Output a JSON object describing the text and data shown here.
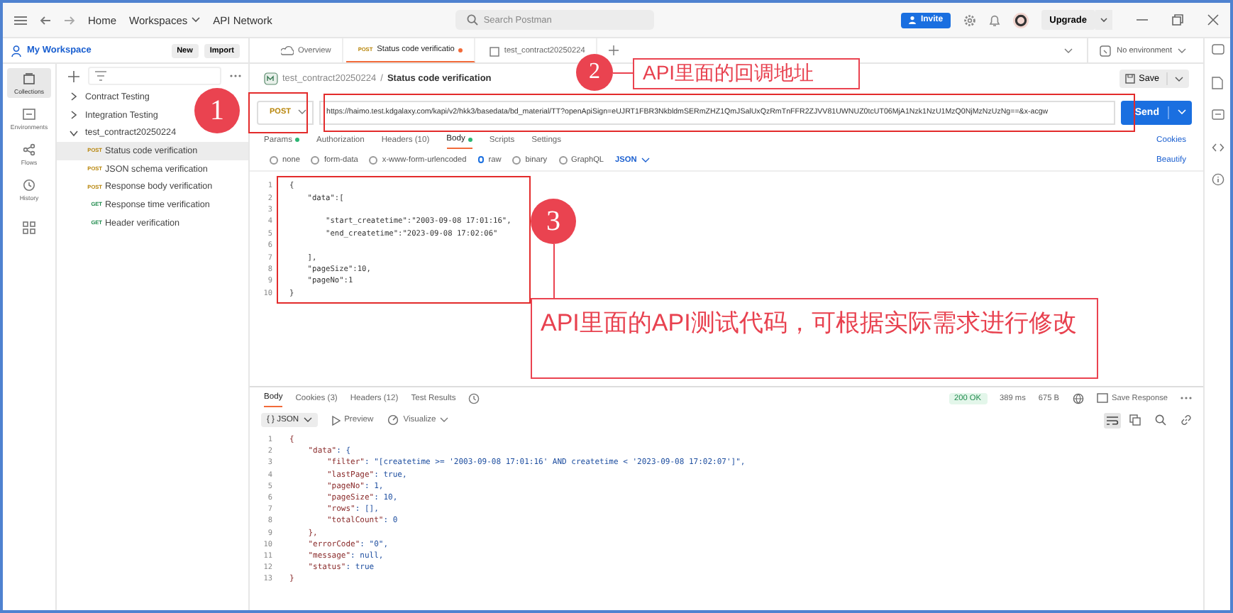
{
  "topbar": {
    "nav": [
      "Home",
      "Workspaces",
      "API Network"
    ],
    "search": {
      "placeholder": "Search Postman"
    },
    "invite": "Invite",
    "upgrade": "Upgrade"
  },
  "sidebar": {
    "workspace": "My Workspace",
    "buttons": [
      "New",
      "Import"
    ],
    "rail": [
      {
        "label": "Collections",
        "kind": "collections",
        "selected": true
      },
      {
        "label": "Environments",
        "kind": "environments",
        "selected": false
      },
      {
        "label": "Flows",
        "kind": "flows",
        "selected": false
      },
      {
        "label": "History",
        "kind": "history",
        "selected": false
      }
    ],
    "tree": [
      {
        "name": "Contract Testing",
        "expanded": false
      },
      {
        "name": "Integration Testing",
        "expanded": false
      },
      {
        "name": "test_contract20250224",
        "expanded": true,
        "children": [
          {
            "method": "POST",
            "name": "Status code verification",
            "selected": true
          },
          {
            "method": "POST",
            "name": "JSON schema verification",
            "selected": false
          },
          {
            "method": "POST",
            "name": "Response body verification",
            "selected": false
          },
          {
            "method": "GET",
            "name": "Response time verification",
            "selected": false
          },
          {
            "method": "GET",
            "name": "Header verification",
            "selected": false
          }
        ]
      }
    ]
  },
  "tabs": [
    {
      "kind": "overview",
      "label": "Overview",
      "selected": false,
      "unsaved": false
    },
    {
      "kind": "request",
      "method": "POST",
      "label": "Status code verificatio",
      "selected": true,
      "unsaved": true
    },
    {
      "kind": "collection",
      "label": "test_contract20250224",
      "selected": false,
      "unsaved": false
    }
  ],
  "environment": "No environment",
  "breadcrumb": {
    "collection": "test_contract20250224",
    "separator": "/",
    "request": "Status code verification"
  },
  "save": "Save",
  "request": {
    "method": "POST",
    "url": "https://haimo.test.kdgalaxy.com/kapi/v2/hkk3/basedata/bd_material/TT?openApiSign=eUJRT1FBR3NkbldmSERmZHZ1QmJSalUxQzRmTnFFR2ZJVV81UWNUZ0tcUT06MjA1Nzk1NzU1MzQ0NjMzNzUzNg==&x-acgw",
    "send": "Send"
  },
  "request_tabs": [
    {
      "label": "Params",
      "dot": true,
      "selected": false
    },
    {
      "label": "Authorization",
      "dot": false,
      "selected": false
    },
    {
      "label": "Headers (10)",
      "dot": false,
      "selected": false
    },
    {
      "label": "Body",
      "dot": true,
      "selected": true
    },
    {
      "label": "Scripts",
      "dot": false,
      "selected": false
    },
    {
      "label": "Settings",
      "dot": false,
      "selected": false
    }
  ],
  "cookies": "Cookies",
  "body_types": [
    {
      "label": "none",
      "selected": false
    },
    {
      "label": "form-data",
      "selected": false
    },
    {
      "label": "x-www-form-urlencoded",
      "selected": false
    },
    {
      "label": "raw",
      "selected": true
    },
    {
      "label": "binary",
      "selected": false
    },
    {
      "label": "GraphQL",
      "selected": false
    }
  ],
  "format": "JSON",
  "beautify": "Beautify",
  "body_lines": [
    {
      "n": "1",
      "text": "{"
    },
    {
      "n": "2",
      "text": "    \"data\":["
    },
    {
      "n": "3"
    },
    {
      "n": "4",
      "text": "        \"start_createtime\":\"2003-09-08 17:01:16\","
    },
    {
      "n": "5",
      "text": "        \"end_createtime\":\"2023-09-08 17:02:06\""
    },
    {
      "n": "6"
    },
    {
      "n": "7",
      "text": "    ],"
    },
    {
      "n": "8",
      "text": "    \"pageSize\":10,"
    },
    {
      "n": "9",
      "text": "    \"pageNo\":1"
    },
    {
      "n": "10",
      "text": "}"
    }
  ],
  "response_tabs": [
    {
      "label": "Body",
      "selected": true
    },
    {
      "label": "Cookies (3)",
      "selected": false
    },
    {
      "label": "Headers (12)",
      "selected": false
    },
    {
      "label": "Test Results",
      "selected": false
    }
  ],
  "response_status": {
    "code": "200 OK",
    "time": "389 ms",
    "size": "675 B",
    "save": "Save Response"
  },
  "response_view": {
    "format_icon": "{ }",
    "format": "JSON",
    "preview": "Preview",
    "visualize": "Visualize"
  },
  "response_lines": [
    {
      "n": "1",
      "key": "{"
    },
    {
      "n": "2",
      "key": "    \"data\"",
      "rest": ": {"
    },
    {
      "n": "3",
      "key": "        \"filter\"",
      "rest": ": \"[createtime >= '2003-09-08 17:01:16' AND createtime < '2023-09-08 17:02:07']\","
    },
    {
      "n": "4",
      "key": "        \"lastPage\"",
      "rest": ": true,"
    },
    {
      "n": "5",
      "key": "        \"pageNo\"",
      "rest": ": 1,"
    },
    {
      "n": "6",
      "key": "        \"pageSize\"",
      "rest": ": 10,"
    },
    {
      "n": "7",
      "key": "        \"rows\"",
      "rest": ": [],"
    },
    {
      "n": "8",
      "key": "        \"totalCount\"",
      "rest": ": 0"
    },
    {
      "n": "9",
      "key": "    },"
    },
    {
      "n": "10",
      "key": "    \"errorCode\"",
      "rest": ": \"0\","
    },
    {
      "n": "11",
      "key": "    \"message\"",
      "rest": ": null,"
    },
    {
      "n": "12",
      "key": "    \"status\"",
      "rest": ": true"
    },
    {
      "n": "13",
      "key": "}"
    }
  ],
  "annotations": [
    {
      "number": "1"
    },
    {
      "number": "2",
      "label": "API里面的回调地址"
    },
    {
      "number": "3",
      "label": "API里面的API测试代码，可根据实际需求进行修改"
    }
  ]
}
